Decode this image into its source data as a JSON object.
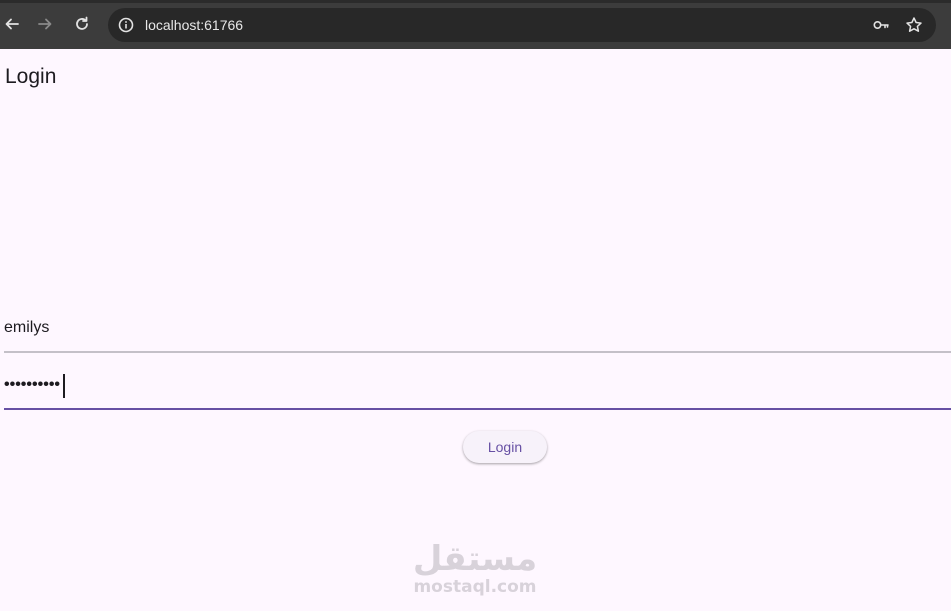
{
  "browser": {
    "url": "localhost:61766",
    "icons": {
      "back": "arrow-left-icon",
      "forward": "arrow-right-icon",
      "reload": "reload-icon",
      "site_info": "info-circle-icon",
      "passwords": "key-icon",
      "bookmark": "star-icon"
    }
  },
  "page": {
    "title": "Login",
    "username": {
      "value": "emilys"
    },
    "password": {
      "masked_value": "••••••••••"
    },
    "login_button": "Login"
  },
  "watermark": {
    "arabic": "مستقل",
    "latin": "mostaql.com"
  },
  "colors": {
    "background": "#fef7ff",
    "accent": "#6750a4",
    "chrome": "#3c3c3c"
  }
}
